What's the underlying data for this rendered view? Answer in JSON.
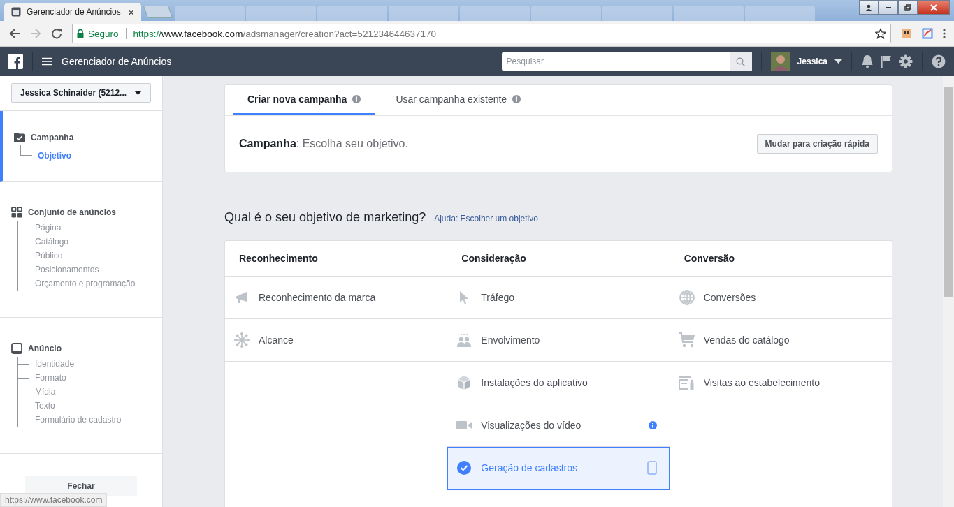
{
  "browser": {
    "tab_title": "Gerenciador de Anúncios",
    "tab_close": "×",
    "security": "Seguro",
    "url": {
      "scheme": "https://",
      "host": "www.facebook.com",
      "path": "/adsmanager/creation?act=521234644637170"
    }
  },
  "header": {
    "app_title": "Gerenciador de Anúncios",
    "search": {
      "placeholder": "Pesquisar"
    },
    "user": "Jessica"
  },
  "sidebar": {
    "account": "Jessica Schinaider (5212...",
    "sections": [
      {
        "title": "Campanha",
        "kind": "folder",
        "active": true,
        "items": [
          {
            "label": "Objetivo",
            "selected": true
          }
        ]
      },
      {
        "title": "Conjunto de anúncios",
        "kind": "grid",
        "active": false,
        "items": [
          {
            "label": "Página",
            "selected": false
          },
          {
            "label": "Catálogo",
            "selected": false
          },
          {
            "label": "Público",
            "selected": false
          },
          {
            "label": "Posicionamentos",
            "selected": false
          },
          {
            "label": "Orçamento e programação",
            "selected": false
          }
        ]
      },
      {
        "title": "Anúncio",
        "kind": "screen",
        "active": false,
        "items": [
          {
            "label": "Identidade",
            "selected": false
          },
          {
            "label": "Formato",
            "selected": false
          },
          {
            "label": "Mídia",
            "selected": false
          },
          {
            "label": "Texto",
            "selected": false
          },
          {
            "label": "Formulário de cadastro",
            "selected": false
          }
        ]
      }
    ],
    "close_button": "Fechar"
  },
  "main": {
    "tabs": [
      {
        "label": "Criar nova campanha",
        "selected": true
      },
      {
        "label": "Usar campanha existente",
        "selected": false
      }
    ],
    "campaign_line": "**Campanha**: Escolha seu objetivo.",
    "quick_button": "Mudar para criação rápida",
    "question": "Qual é o seu objetivo de marketing?",
    "help_link": "Ajuda: Escolher um objetivo",
    "columns": [
      {
        "title": "Reconhecimento",
        "items": [
          {
            "label": "Reconhecimento da marca",
            "kind": "megaphone",
            "selected": false,
            "info": false
          },
          {
            "label": "Alcance",
            "kind": "network",
            "selected": false,
            "info": false
          }
        ]
      },
      {
        "title": "Consideração",
        "items": [
          {
            "label": "Tráfego",
            "kind": "cursor",
            "selected": false,
            "info": false
          },
          {
            "label": "Envolvimento",
            "kind": "people",
            "selected": false,
            "info": false
          },
          {
            "label": "Instalações do aplicativo",
            "kind": "cube",
            "selected": false,
            "info": false
          },
          {
            "label": "Visualizações do vídeo",
            "kind": "video",
            "selected": false,
            "info": true
          },
          {
            "label": "Geração de cadastros",
            "selected": true,
            "info": false
          }
        ]
      },
      {
        "title": "Conversão",
        "items": [
          {
            "label": "Conversões",
            "kind": "globe",
            "selected": false,
            "info": false
          },
          {
            "label": "Vendas do catálogo",
            "kind": "cart",
            "selected": false,
            "info": false
          },
          {
            "label": "Visitas ao estabelecimento",
            "kind": "store",
            "selected": false,
            "info": false
          }
        ]
      }
    ]
  },
  "status_url": "https://www.facebook.com"
}
